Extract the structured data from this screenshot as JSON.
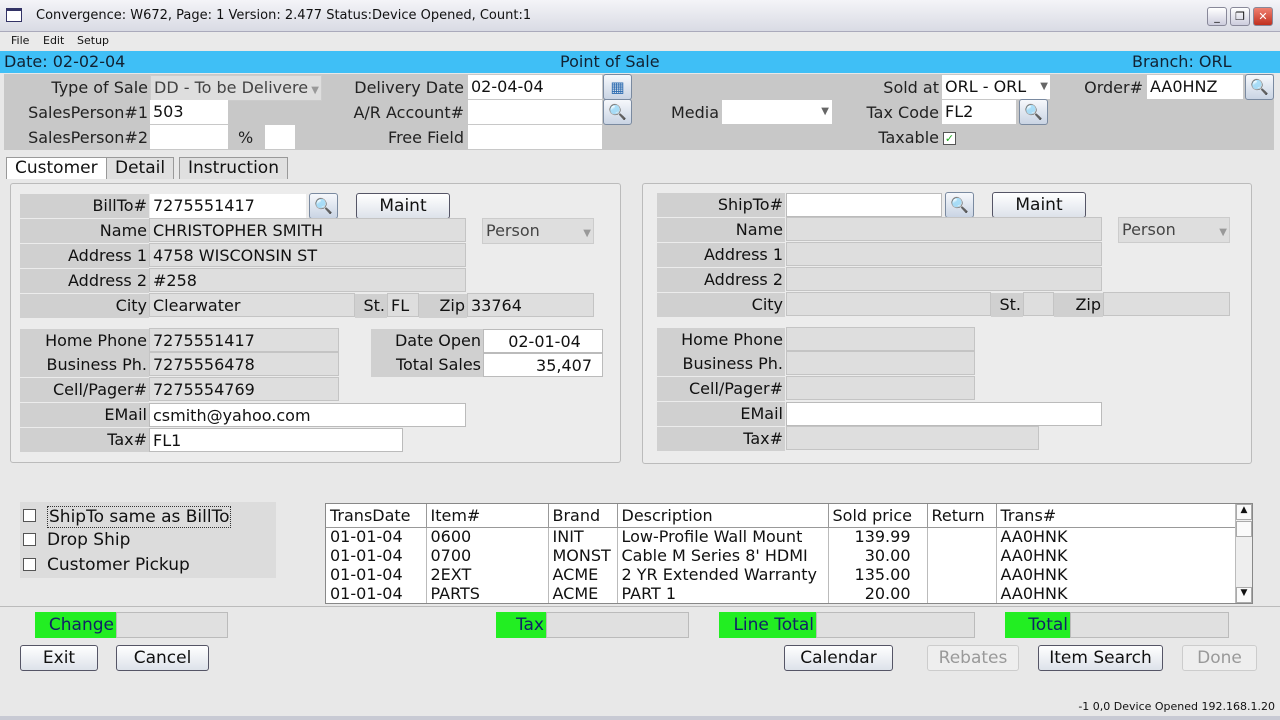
{
  "window": {
    "title": "Convergence: W672,  Page: 1  Version: 2.477  Status:Device Opened, Count:1"
  },
  "menu": [
    "File",
    "Edit",
    "Setup"
  ],
  "band": {
    "date": "Date: 02-02-04",
    "title": "Point of Sale",
    "branch": "Branch: ORL"
  },
  "header": {
    "type_of_sale_label": "Type of Sale",
    "type_of_sale": "DD - To be Delivere",
    "sp1_label": "SalesPerson#1",
    "sp1": "503",
    "sp2_label": "SalesPerson#2",
    "sp2": "",
    "pct_label": "%",
    "pct": "",
    "delivery_date_label": "Delivery Date",
    "delivery_date": "02-04-04",
    "ar_label": "A/R Account#",
    "ar": "",
    "free_label": "Free Field",
    "free": "",
    "media_label": "Media",
    "media": "",
    "sold_at_label": "Sold at",
    "sold_at": "ORL  - ORL",
    "tax_code_label": "Tax Code",
    "tax_code": "FL2",
    "taxable_label": "Taxable",
    "taxable": true,
    "order_label": "Order#",
    "order": "AA0HNZ"
  },
  "tabs": [
    "Customer",
    "Detail",
    "Instruction"
  ],
  "billto": {
    "billto_label": "BillTo#",
    "billto": "7275551417",
    "maint": "Maint",
    "name_label": "Name",
    "name": "CHRISTOPHER SMITH",
    "type": "Person",
    "addr1_label": "Address 1",
    "addr1": "4758 WISCONSIN ST",
    "addr2_label": "Address 2",
    "addr2": "#258",
    "city_label": "City",
    "city": "Clearwater",
    "st_label": "St.",
    "st": "FL",
    "zip_label": "Zip",
    "zip": "33764",
    "home_label": "Home Phone",
    "home": "7275551417",
    "bus_label": "Business Ph.",
    "bus": "7275556478",
    "cell_label": "Cell/Pager#",
    "cell": "7275554769",
    "email_label": "EMail",
    "email": "csmith@yahoo.com",
    "tax_label": "Tax#",
    "tax": "FL1",
    "date_open_label": "Date Open",
    "date_open": "02-01-04",
    "total_sales_label": "Total Sales",
    "total_sales": "35,407"
  },
  "shipto": {
    "shipto_label": "ShipTo#",
    "maint": "Maint",
    "name_label": "Name",
    "type": "Person",
    "addr1_label": "Address 1",
    "addr2_label": "Address 2",
    "city_label": "City",
    "st_label": "St.",
    "zip_label": "Zip",
    "home_label": "Home Phone",
    "bus_label": "Business Ph.",
    "cell_label": "Cell/Pager#",
    "email_label": "EMail",
    "tax_label": "Tax#"
  },
  "options": [
    "ShipTo same as BillTo",
    "Drop Ship",
    "Customer Pickup"
  ],
  "table": {
    "columns": [
      "TransDate",
      "Item#",
      "Brand",
      "Description",
      "Sold price",
      "Return",
      "Trans#"
    ],
    "rows": [
      [
        "01-01-04",
        "0600",
        "INIT",
        "Low-Profile Wall Mount",
        "139.99",
        "",
        "AA0HNK"
      ],
      [
        "01-01-04",
        "0700",
        "MONST",
        "Cable M Series 8' HDMI",
        "30.00",
        "",
        "AA0HNK"
      ],
      [
        "01-01-04",
        "2EXT",
        "ACME",
        "2 YR Extended Warranty",
        "135.00",
        "",
        "AA0HNK"
      ],
      [
        "01-01-04",
        "PARTS",
        "ACME",
        "PART 1",
        "20.00",
        "",
        "AA0HNK"
      ]
    ]
  },
  "totals": {
    "change": "Change",
    "tax": "Tax",
    "line_total": "Line Total",
    "total": "Total"
  },
  "buttons": {
    "exit": "Exit",
    "cancel": "Cancel",
    "calendar": "Calendar",
    "rebates": "Rebates",
    "item_search": "Item Search",
    "done": "Done"
  },
  "status": "-1  0,0  Device Opened  192.168.1.20"
}
